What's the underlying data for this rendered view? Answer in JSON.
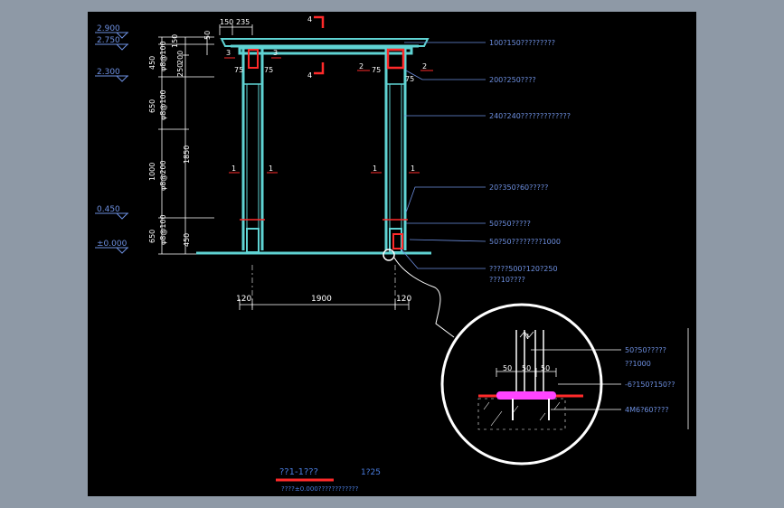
{
  "colors": {
    "outside": "#8e99a6",
    "background": "#000000",
    "structure": "#5fd3d3",
    "dim": "#ffffff",
    "callout": "#6d8fe0",
    "section": "#ff2a2a",
    "plate": "#ff44ff",
    "annotation": "#4a7de0"
  },
  "elevations": [
    "2.900",
    "2.750",
    "2.300",
    "0.450",
    "±0.000"
  ],
  "left_dims": {
    "top": [
      "150",
      "50"
    ],
    "rebar": [
      "φ8@100",
      "φ8@100",
      "φ8@200",
      "φ8@100"
    ],
    "segments": [
      "450",
      "650",
      "1000",
      "650"
    ],
    "right": [
      "200",
      "250",
      "1850",
      "450"
    ]
  },
  "top_dims": [
    "150",
    "235"
  ],
  "section_marks": {
    "cut4": "4",
    "cut3": "3",
    "cut2": "2",
    "cut1": "1"
  },
  "inner_dims": [
    "75",
    "75",
    "75",
    "75"
  ],
  "callouts": [
    "100?150?????????",
    "200?250????",
    "240?240?????????????",
    "20?350?60?????",
    "50?50?????",
    "50?50????????1000",
    "?????500?120?250",
    "???10????"
  ],
  "bottom_dims": [
    "120",
    "1900",
    "120"
  ],
  "detail": {
    "top_label": "N",
    "dims": [
      "50",
      "50",
      "50"
    ],
    "notes": [
      "50?50?????",
      "??1000",
      "-6?150?150??",
      "4M6?60????"
    ]
  },
  "title": {
    "main": "??1-1???",
    "scale": "1?25",
    "note": "????±0.000????????????"
  }
}
